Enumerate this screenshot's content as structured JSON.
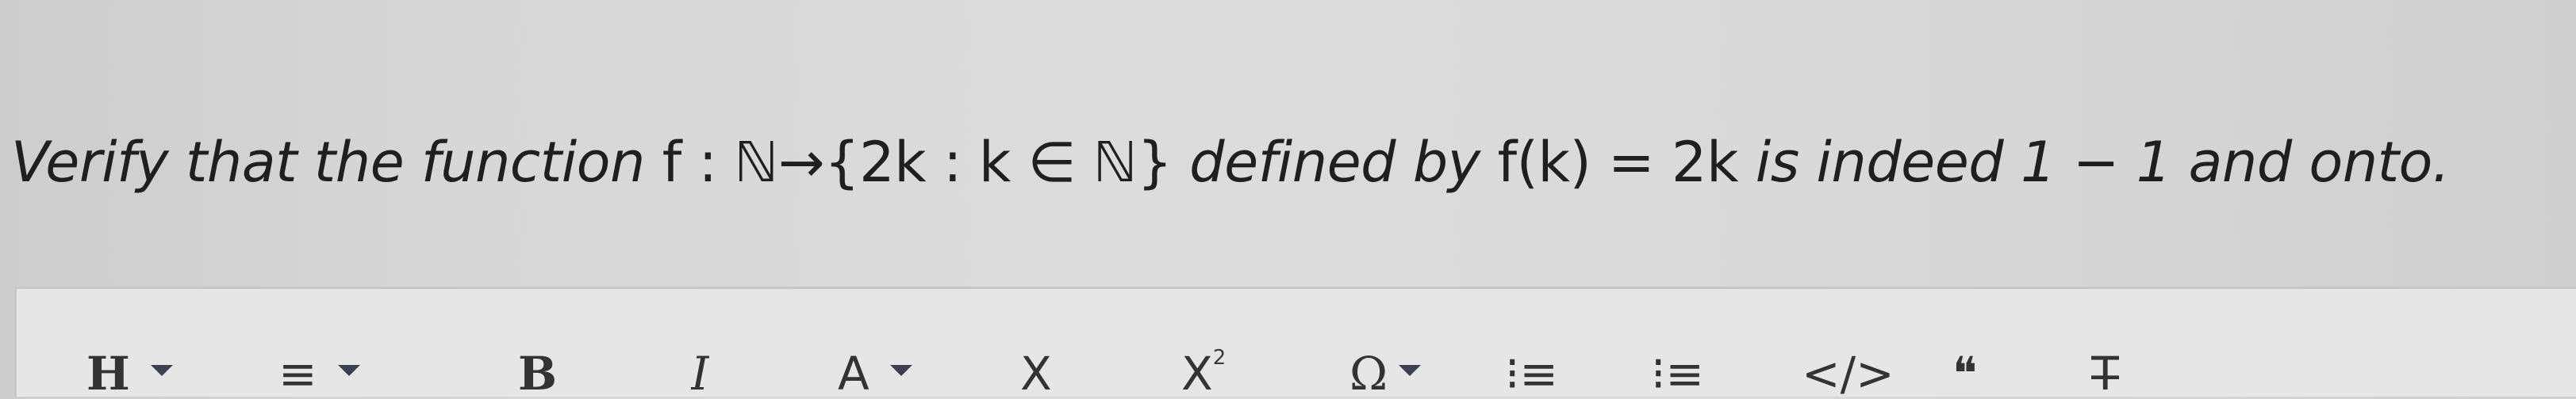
{
  "question": {
    "part1": "Verify that the function ",
    "math1": "f : ℕ→{2k : k ∈ ℕ}",
    "part2": " defined by ",
    "math2": "f(k) = 2k",
    "part3": " is indeed 1 − 1 and onto."
  },
  "toolbar": {
    "heading": "H",
    "align": "≡",
    "bold": "B",
    "italic": "I",
    "text_color": "A",
    "subscript": "X",
    "superscript": "X",
    "superscript_mark": "2",
    "omega": "Ω",
    "bullet_list": "⁝≡",
    "numbered_list": "⁝≡",
    "code": "</>",
    "quote": "❝",
    "clear_format": "T̶"
  },
  "icons": {
    "dropdown": "caret-down-icon"
  },
  "colors": {
    "background": "#d7d7d7",
    "toolbar": "#e6e6e6",
    "text": "#1f1f1f",
    "caret": "#3b4150"
  }
}
